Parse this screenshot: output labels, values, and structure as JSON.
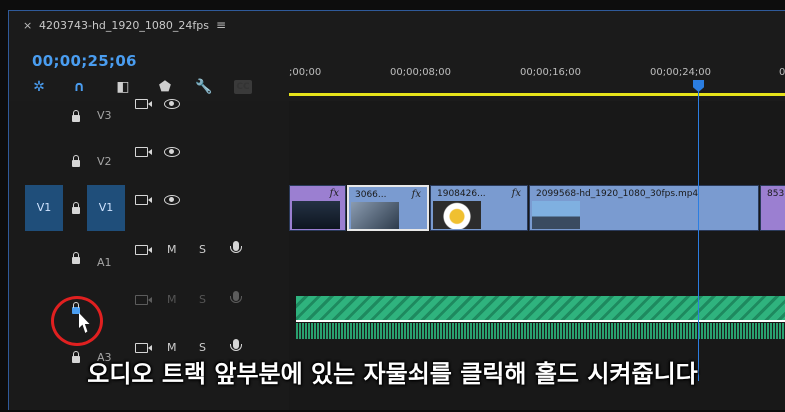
{
  "tab": {
    "close": "×",
    "title": "4203743-hd_1920_1080_24fps",
    "menu": "≡"
  },
  "timecode": "00;00;25;06",
  "tools": [
    {
      "name": "snap-icon",
      "glyph": "✲"
    },
    {
      "name": "magnet-icon",
      "glyph": "∩"
    },
    {
      "name": "linked-selection-icon",
      "glyph": "◧"
    },
    {
      "name": "marker-icon",
      "glyph": "⬟"
    },
    {
      "name": "wrench-icon",
      "glyph": "🔧"
    },
    {
      "name": "captions-icon",
      "glyph": "CC"
    }
  ],
  "ruler": {
    "labels": [
      ";00;00",
      "00;00;08;00",
      "00;00;16;00",
      "00;00;24;00",
      "0"
    ]
  },
  "tracks": {
    "v3": "V3",
    "v2": "V2",
    "v1": "V1",
    "v1_source": "V1",
    "a1": "A1",
    "a3": "A3",
    "mute": "M",
    "solo": "S"
  },
  "clips": [
    {
      "name": "",
      "fx": "fx",
      "color": "#9b7fd1"
    },
    {
      "name": "3066...",
      "fx": "fx",
      "color": "#7a9bd0"
    },
    {
      "name": "1908426...",
      "fx": "fx",
      "color": "#7a9bd0"
    },
    {
      "name": "2099568-hd_1920_1080_30fps.mp4",
      "fx": "",
      "color": "#7a9bd0"
    },
    {
      "name": "853",
      "fx": "",
      "color": "#9b7fd1"
    }
  ],
  "subtitle": "오디오 트랙 앞부분에 있는 자물쇠를 클릭해 홀드 시켜줍니다"
}
